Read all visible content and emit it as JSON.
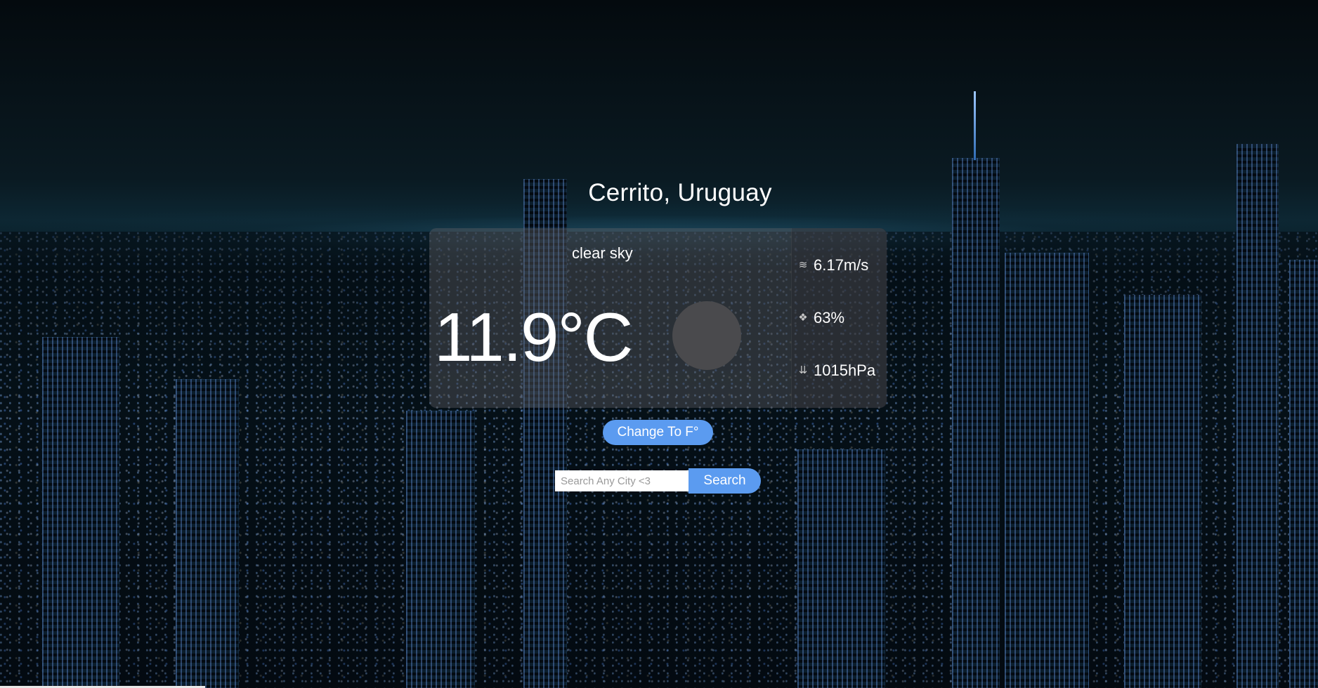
{
  "location": {
    "title": "Cerrito, Uruguay"
  },
  "weather": {
    "description": "clear sky",
    "temperature": "11.9°C",
    "icon": "weather-icon-placeholder"
  },
  "stats": [
    {
      "icon": "wind-icon",
      "value": "6.17m/s"
    },
    {
      "icon": "humidity-icon",
      "value": "63%"
    },
    {
      "icon": "pressure-icon",
      "value": "1015hPa"
    }
  ],
  "controls": {
    "unit_toggle_label": "Change To F°",
    "search_placeholder": "Search Any City <3",
    "search_value": "",
    "search_button_label": "Search"
  },
  "colors": {
    "accent": "#5b9bf0",
    "card": "#5f5f64",
    "text": "#ffffff"
  }
}
